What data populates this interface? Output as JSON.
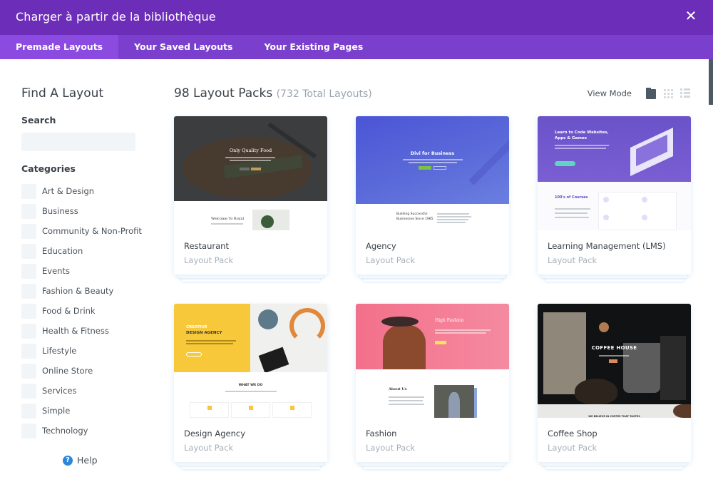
{
  "header": {
    "title": "Charger à partir de la bibliothèque",
    "close_icon": "close-icon"
  },
  "tabs": [
    {
      "label": "Premade Layouts",
      "active": true
    },
    {
      "label": "Your Saved Layouts",
      "active": false
    },
    {
      "label": "Your Existing Pages",
      "active": false
    }
  ],
  "sidebar": {
    "title": "Find A Layout",
    "search_label": "Search",
    "search_value": "",
    "search_placeholder": "",
    "categories_label": "Categories",
    "categories": [
      {
        "label": "Art & Design",
        "checked": false
      },
      {
        "label": "Business",
        "checked": false
      },
      {
        "label": "Community & Non-Profit",
        "checked": false
      },
      {
        "label": "Education",
        "checked": false
      },
      {
        "label": "Events",
        "checked": false
      },
      {
        "label": "Fashion & Beauty",
        "checked": false
      },
      {
        "label": "Food & Drink",
        "checked": false
      },
      {
        "label": "Health & Fitness",
        "checked": false
      },
      {
        "label": "Lifestyle",
        "checked": false
      },
      {
        "label": "Online Store",
        "checked": false
      },
      {
        "label": "Services",
        "checked": false
      },
      {
        "label": "Simple",
        "checked": false
      },
      {
        "label": "Technology",
        "checked": false
      }
    ],
    "help_label": "Help",
    "help_icon": "question-circle-icon"
  },
  "main": {
    "count_title": "98 Layout Packs",
    "count_sub": "(732 Total Layouts)",
    "view_mode_label": "View Mode",
    "view_modes": [
      {
        "icon": "folder-icon",
        "active": true
      },
      {
        "icon": "grid-icon",
        "active": false
      },
      {
        "icon": "list-icon",
        "active": false
      }
    ],
    "cards": [
      {
        "name": "Restaurant",
        "type": "Layout Pack",
        "hero_text": "Only Quality Food",
        "lower_text": "Welcome To Royal"
      },
      {
        "name": "Agency",
        "type": "Layout Pack",
        "hero_text": "Divi for Business",
        "lower_text_1": "Building Successful",
        "lower_text_2": "Businesses Since 1985"
      },
      {
        "name": "Learning Management (LMS)",
        "type": "Layout Pack",
        "hero_text_1": "Learn to Code Websites,",
        "hero_text_2": "Apps & Games",
        "lower_text": "100's of Courses"
      },
      {
        "name": "Design Agency",
        "type": "Layout Pack",
        "hero_text_1": "CREATIVE",
        "hero_text_2": "DESIGN AGENCY",
        "lower_text": "WHAT WE DO"
      },
      {
        "name": "Fashion",
        "type": "Layout Pack",
        "hero_text": "High Fashion",
        "lower_text": "About Us"
      },
      {
        "name": "Coffee Shop",
        "type": "Layout Pack",
        "hero_text": "COFFEE HOUSE",
        "lower_text": "WE BELIEVE IN COFFEE THAT TASTES"
      }
    ]
  },
  "colors": {
    "header_bg": "#6c2eb9",
    "tabs_bg": "#7b3fce",
    "tab_active_bg": "#8c4be0",
    "help_blue": "#2b87da"
  }
}
